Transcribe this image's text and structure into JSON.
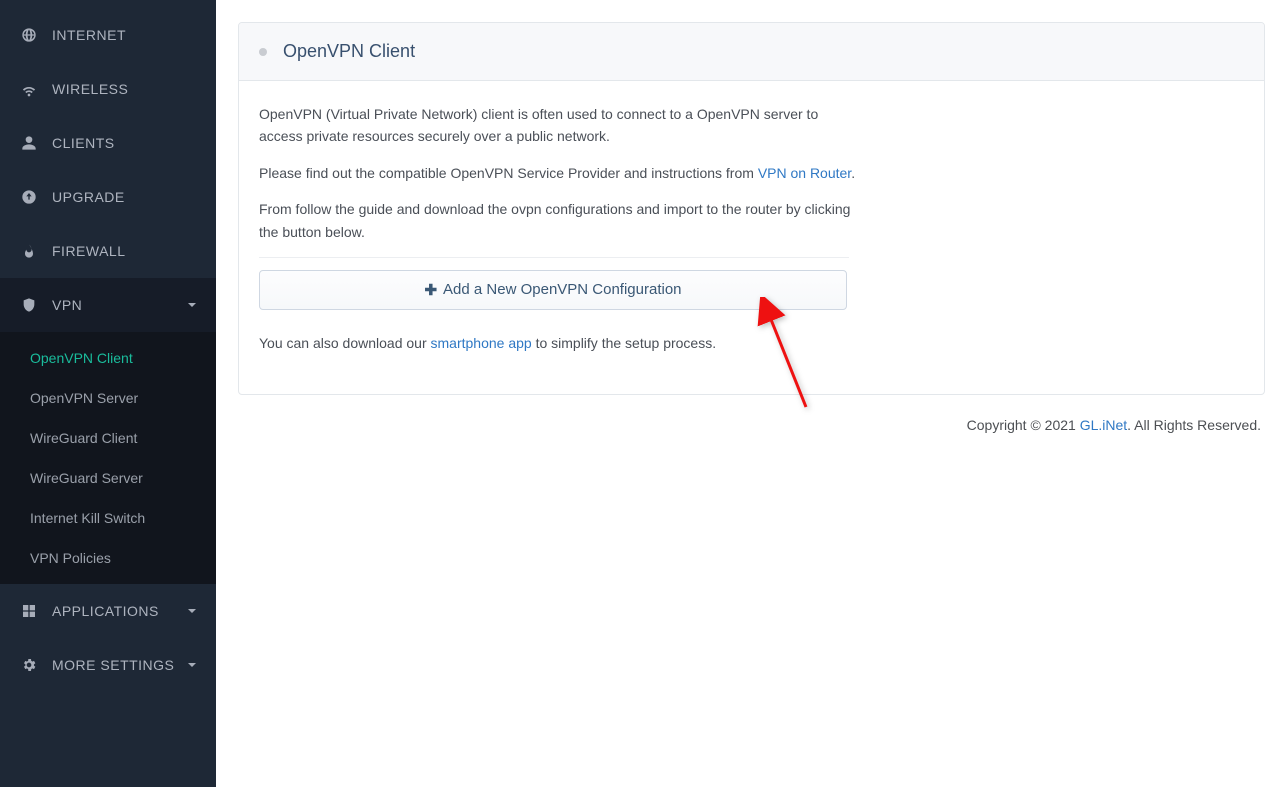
{
  "sidebar": {
    "items": [
      {
        "label": "INTERNET",
        "icon": "globe"
      },
      {
        "label": "WIRELESS",
        "icon": "wifi"
      },
      {
        "label": "CLIENTS",
        "icon": "user"
      },
      {
        "label": "UPGRADE",
        "icon": "upload-circle"
      },
      {
        "label": "FIREWALL",
        "icon": "flame"
      },
      {
        "label": "VPN",
        "icon": "shield",
        "caret": true,
        "active": true,
        "sub": [
          {
            "label": "OpenVPN Client",
            "active": true
          },
          {
            "label": "OpenVPN Server"
          },
          {
            "label": "WireGuard Client"
          },
          {
            "label": "WireGuard Server"
          },
          {
            "label": "Internet Kill Switch"
          },
          {
            "label": "VPN Policies"
          }
        ]
      },
      {
        "label": "APPLICATIONS",
        "icon": "grid",
        "caret": true
      },
      {
        "label": "MORE SETTINGS",
        "icon": "gear",
        "caret": true
      }
    ]
  },
  "page": {
    "title": "OpenVPN Client",
    "intro": "OpenVPN (Virtual Private Network) client is often used to connect to a OpenVPN server to access private resources securely over a public network.",
    "provider_prefix": "Please find out the compatible OpenVPN Service Provider and instructions from ",
    "provider_link": "VPN on Router",
    "provider_suffix": ".",
    "guide_text": "From follow the guide and download the ovpn configurations and import to the router by clicking the button below.",
    "add_button": "Add a New OpenVPN Configuration",
    "app_prefix": "You can also download our ",
    "app_link": "smartphone app",
    "app_suffix": " to simplify the setup process."
  },
  "footer": {
    "copyright_prefix": "Copyright © 2021 ",
    "brand": "GL.iNet",
    "copyright_suffix": ". All Rights Reserved."
  }
}
